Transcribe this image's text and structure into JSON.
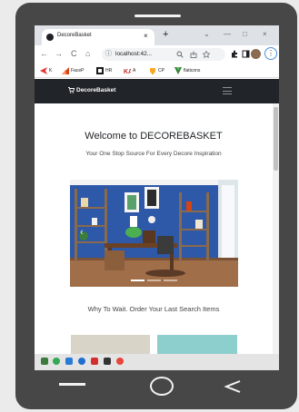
{
  "browser": {
    "tab_title": "DecoreBasket",
    "tab_close": "×",
    "new_tab": "+",
    "win_chevron": "⌄",
    "win_minimize": "—",
    "win_maximize": "□",
    "win_close": "×",
    "url": "localhost:42...",
    "menu_glyph": "⋮",
    "back_glyph": "←",
    "forward_glyph": "→",
    "reload_glyph": "C",
    "home_glyph": "⌂",
    "info_glyph": "ⓘ"
  },
  "bookmarks": [
    {
      "label": "K",
      "color": "#e53935"
    },
    {
      "label": "FaceP",
      "color": "#d84315"
    },
    {
      "label": "HR",
      "color": "#1a1a1a"
    },
    {
      "label": "A",
      "color": "#c62828"
    },
    {
      "label": "CP",
      "color": "#f9a825"
    },
    {
      "label": "flaticons",
      "color": "#2e7d32"
    }
  ],
  "site": {
    "brand": "DecoreBasket",
    "welcome": "Welcome to DECOREBASKET",
    "subtitle": "Your One Stop Source For Every Decore Inspiration",
    "carousel_prev": "‹",
    "why_heading": "Why To Wait. Order Your Last Search Items"
  },
  "colors": {
    "header_bg": "#212529",
    "wall_blue": "#2e58a8",
    "card_teal": "#8ccfcc"
  }
}
